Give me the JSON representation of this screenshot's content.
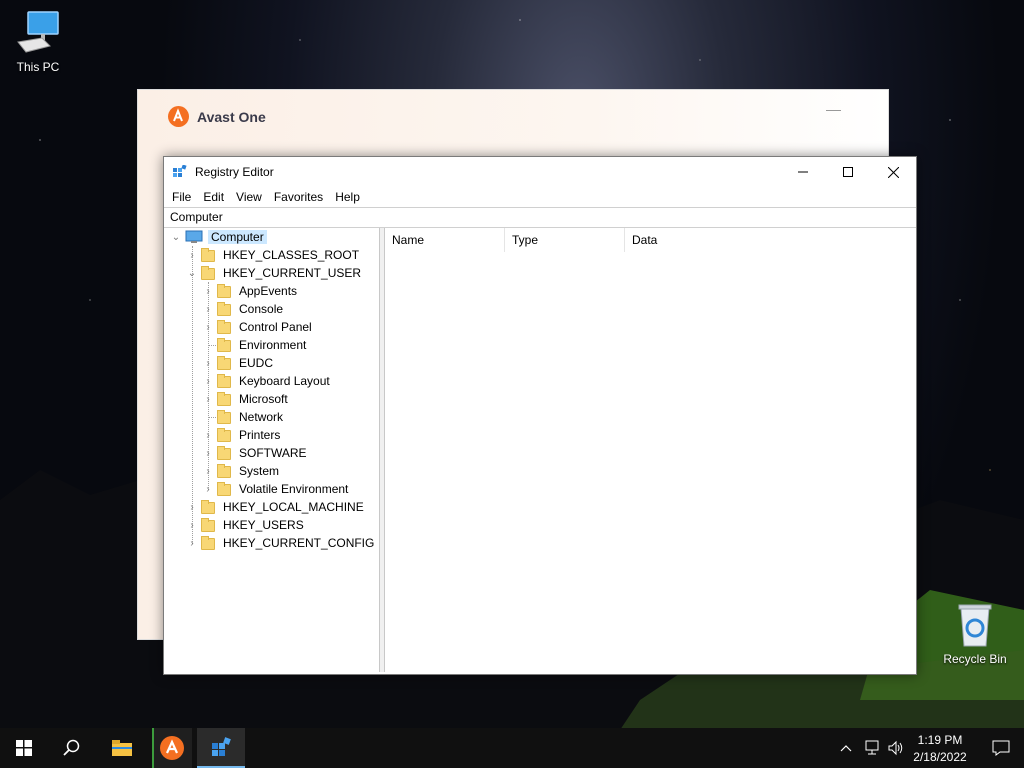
{
  "desktop": {
    "this_pc_label": "This PC",
    "recycle_bin_label": "Recycle Bin"
  },
  "avast": {
    "title": "Avast One",
    "accent": "#f46f21"
  },
  "regedit": {
    "title": "Registry Editor",
    "menu": [
      "File",
      "Edit",
      "View",
      "Favorites",
      "Help"
    ],
    "address": "Computer",
    "columns": [
      "Name",
      "Type",
      "Data"
    ],
    "tree": {
      "root": "Computer",
      "hives": {
        "classes_root": "HKEY_CLASSES_ROOT",
        "current_user": "HKEY_CURRENT_USER",
        "local_machine": "HKEY_LOCAL_MACHINE",
        "users": "HKEY_USERS",
        "current_config": "HKEY_CURRENT_CONFIG"
      },
      "current_user_children": [
        "AppEvents",
        "Console",
        "Control Panel",
        "Environment",
        "EUDC",
        "Keyboard Layout",
        "Microsoft",
        "Network",
        "Printers",
        "SOFTWARE",
        "System",
        "Volatile Environment"
      ]
    }
  },
  "taskbar": {
    "time": "1:19 PM",
    "date": "2/18/2022"
  }
}
